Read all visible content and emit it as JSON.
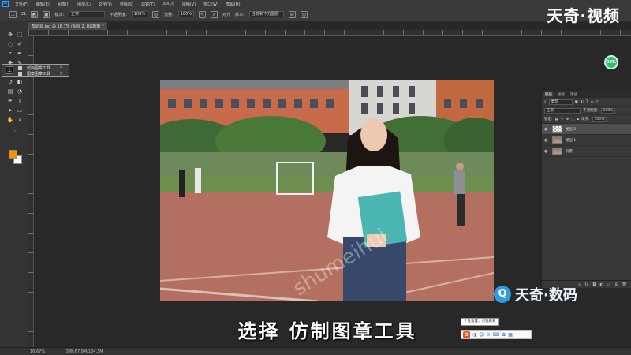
{
  "app": {
    "logo": "Ps"
  },
  "menubar": {
    "items": [
      "文件(F)",
      "编辑(E)",
      "图像(I)",
      "图层(L)",
      "文字(Y)",
      "选择(S)",
      "滤镜(T)",
      "3D(D)",
      "视图(V)",
      "窗口(W)",
      "帮助(H)"
    ]
  },
  "options": {
    "brush_size": "21",
    "mode_label": "模式:",
    "mode_value": "正常",
    "opacity_label": "不透明度:",
    "opacity_value": "100%",
    "flow_label": "流量:",
    "flow_value": "100%",
    "aligned_label": "对齐",
    "sample_label": "样本:",
    "sample_value": "当前和下方图层"
  },
  "document": {
    "tab_title": "帮助源.jpg @ 16.7% (图层 2, RGB/8) *"
  },
  "tool_flyout": {
    "items": [
      {
        "label": "仿制图章工具",
        "shortcut": "S"
      },
      {
        "label": "图案图章工具",
        "shortcut": "S"
      }
    ]
  },
  "zoom_badge": "28%",
  "layers_panel": {
    "tabs": [
      "图层",
      "通道",
      "路径"
    ],
    "filter_value": "类型",
    "blend_mode": "正常",
    "opacity_label": "不透明度:",
    "opacity_value": "100%",
    "lock_label": "锁定:",
    "fill_label": "填充:",
    "fill_value": "100%",
    "layers": [
      {
        "name": "图层 2",
        "selected": true
      },
      {
        "name": "图层 1",
        "selected": false
      },
      {
        "name": "背景",
        "selected": false
      }
    ]
  },
  "watermarks": {
    "top_right": "天奇·视频",
    "bottom_right": "天奇·数码",
    "bottom_icon": "Q",
    "diagonal": "shumeihui"
  },
  "subtitle": "选择 仿制图章工具",
  "ime": {
    "tooltip": "个性设置，点我看看",
    "badge": "S"
  },
  "statusbar": {
    "zoom": "16.67%",
    "doc_info": "文档:67.9M/134.3M"
  }
}
